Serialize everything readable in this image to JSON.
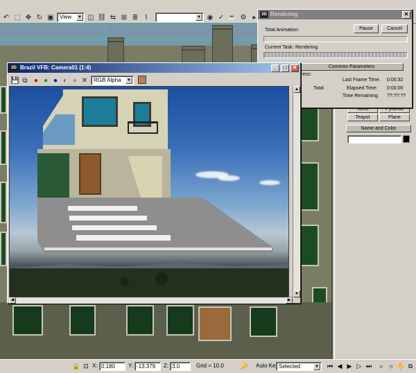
{
  "toolbar": {
    "view_dropdown": "View"
  },
  "rendering_window": {
    "title": "Rendering",
    "total_animation_label": "Total Animation:",
    "pause_label": "Pause",
    "cancel_label": "Cancel",
    "current_task_label": "Current Task:",
    "current_task_value": "Rendering",
    "common_parameters_label": "Common Parameters",
    "progress_label": "gress:",
    "total_label": "Total",
    "last_frame_time_label": "Last Frame Time:",
    "last_frame_time_value": "0:00:32",
    "elapsed_time_label": "Elapsed Time:",
    "elapsed_time_value": "0:00:00",
    "time_remaining_label": "Time Remaining:",
    "time_remaining_value": "??:??:??"
  },
  "command_panel": {
    "button_1": "Torus",
    "button_2": "Pyramid",
    "button_3": "Teapot",
    "button_4": "Plane",
    "rollout_name_color": "Name and Color",
    "object_name": ""
  },
  "vfb_window": {
    "title": "Brazil VFB: Camera01 (1:4)",
    "channel_dropdown": "RGB Alpha"
  },
  "status_bar": {
    "x_label": "X:",
    "x_value": "0.180",
    "y_label": "Y:",
    "y_value": "-13.379",
    "z_label": "Z:",
    "z_value": "3.0",
    "grid_label": "Grid = 10.0",
    "auto_key_label": "Auto Key",
    "selected_dropdown": "Selected"
  },
  "colors": {
    "swatch_brown": "#c07f4a",
    "color_swatch_black": "#000000"
  }
}
